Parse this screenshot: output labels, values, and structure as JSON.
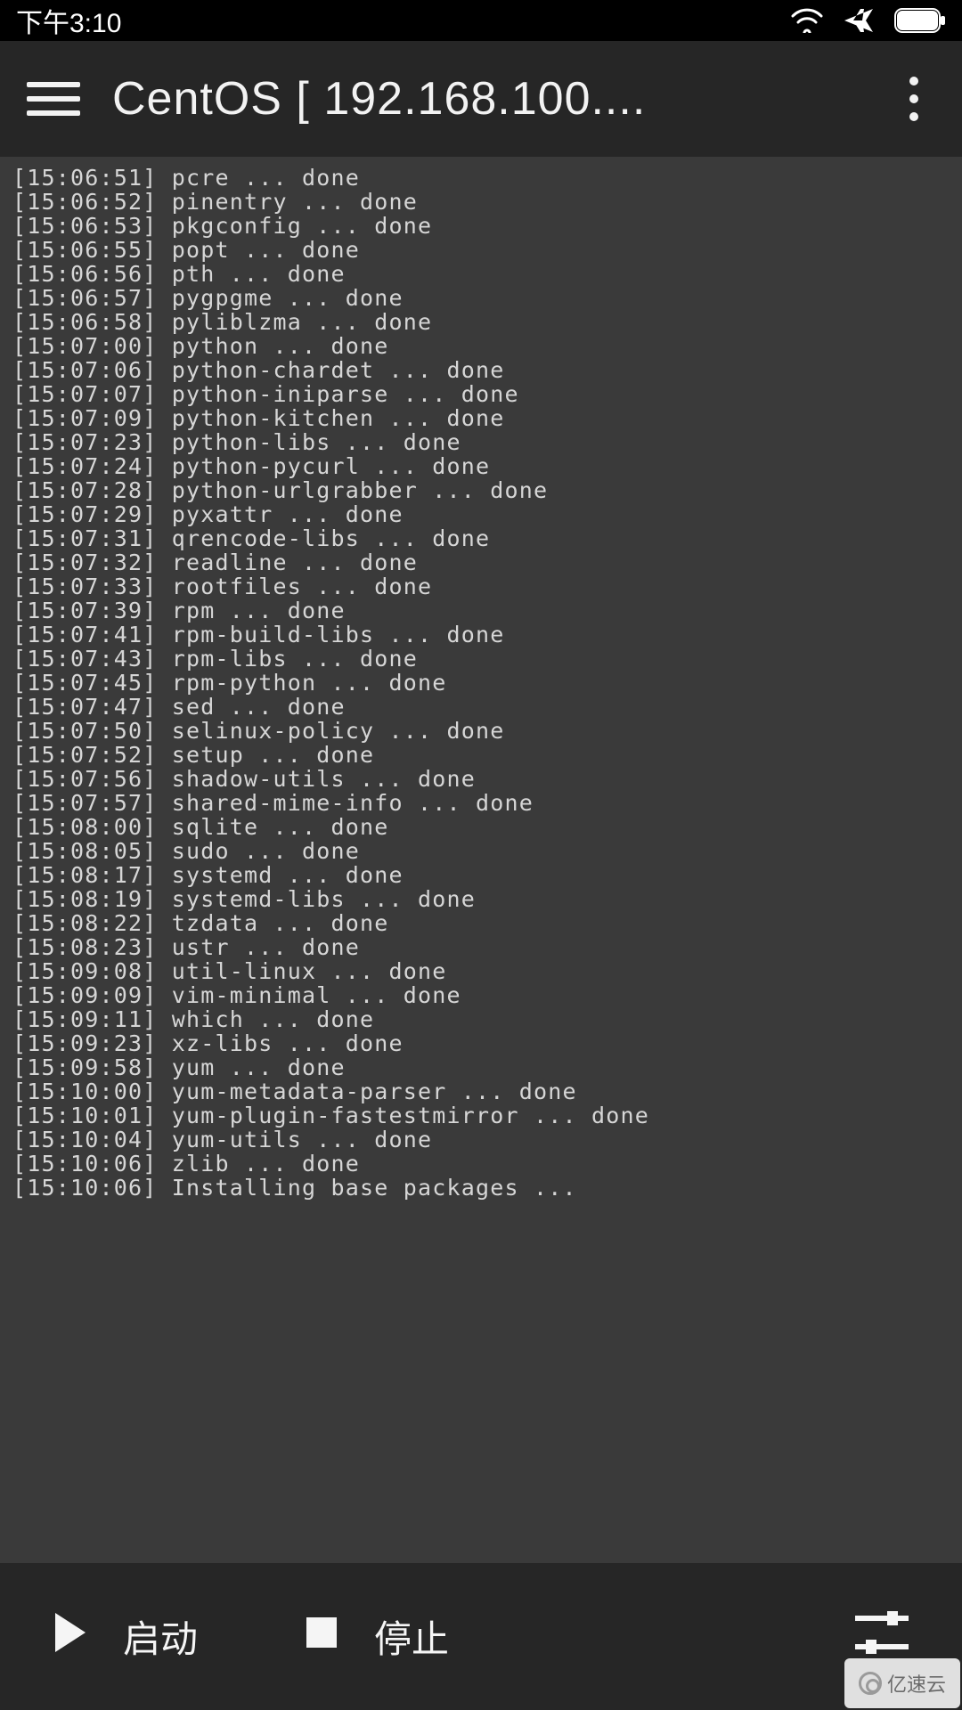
{
  "status_bar": {
    "time": "下午3:10"
  },
  "header": {
    "title": "CentOS  [ 192.168.100...."
  },
  "terminal": {
    "lines": [
      {
        "ts": "15:06:51",
        "text": "pcre ... done"
      },
      {
        "ts": "15:06:52",
        "text": "pinentry ... done"
      },
      {
        "ts": "15:06:53",
        "text": "pkgconfig ... done"
      },
      {
        "ts": "15:06:55",
        "text": "popt ... done"
      },
      {
        "ts": "15:06:56",
        "text": "pth ... done"
      },
      {
        "ts": "15:06:57",
        "text": "pygpgme ... done"
      },
      {
        "ts": "15:06:58",
        "text": "pyliblzma ... done"
      },
      {
        "ts": "15:07:00",
        "text": "python ... done"
      },
      {
        "ts": "15:07:06",
        "text": "python-chardet ... done"
      },
      {
        "ts": "15:07:07",
        "text": "python-iniparse ... done"
      },
      {
        "ts": "15:07:09",
        "text": "python-kitchen ... done"
      },
      {
        "ts": "15:07:23",
        "text": "python-libs ... done"
      },
      {
        "ts": "15:07:24",
        "text": "python-pycurl ... done"
      },
      {
        "ts": "15:07:28",
        "text": "python-urlgrabber ... done"
      },
      {
        "ts": "15:07:29",
        "text": "pyxattr ... done"
      },
      {
        "ts": "15:07:31",
        "text": "qrencode-libs ... done"
      },
      {
        "ts": "15:07:32",
        "text": "readline ... done"
      },
      {
        "ts": "15:07:33",
        "text": "rootfiles ... done"
      },
      {
        "ts": "15:07:39",
        "text": "rpm ... done"
      },
      {
        "ts": "15:07:41",
        "text": "rpm-build-libs ... done"
      },
      {
        "ts": "15:07:43",
        "text": "rpm-libs ... done"
      },
      {
        "ts": "15:07:45",
        "text": "rpm-python ... done"
      },
      {
        "ts": "15:07:47",
        "text": "sed ... done"
      },
      {
        "ts": "15:07:50",
        "text": "selinux-policy ... done"
      },
      {
        "ts": "15:07:52",
        "text": "setup ... done"
      },
      {
        "ts": "15:07:56",
        "text": "shadow-utils ... done"
      },
      {
        "ts": "15:07:57",
        "text": "shared-mime-info ... done"
      },
      {
        "ts": "15:08:00",
        "text": "sqlite ... done"
      },
      {
        "ts": "15:08:05",
        "text": "sudo ... done"
      },
      {
        "ts": "15:08:17",
        "text": "systemd ... done"
      },
      {
        "ts": "15:08:19",
        "text": "systemd-libs ... done"
      },
      {
        "ts": "15:08:22",
        "text": "tzdata ... done"
      },
      {
        "ts": "15:08:23",
        "text": "ustr ... done"
      },
      {
        "ts": "15:09:08",
        "text": "util-linux ... done"
      },
      {
        "ts": "15:09:09",
        "text": "vim-minimal ... done"
      },
      {
        "ts": "15:09:11",
        "text": "which ... done"
      },
      {
        "ts": "15:09:23",
        "text": "xz-libs ... done"
      },
      {
        "ts": "15:09:58",
        "text": "yum ... done"
      },
      {
        "ts": "15:10:00",
        "text": "yum-metadata-parser ... done"
      },
      {
        "ts": "15:10:01",
        "text": "yum-plugin-fastestmirror ... done"
      },
      {
        "ts": "15:10:04",
        "text": "yum-utils ... done"
      },
      {
        "ts": "15:10:06",
        "text": "zlib ... done"
      },
      {
        "ts": "15:10:06",
        "text": "Installing base packages ..."
      }
    ]
  },
  "bottom_bar": {
    "start_label": "启动",
    "stop_label": "停止"
  },
  "watermark": {
    "text": "亿速云"
  }
}
